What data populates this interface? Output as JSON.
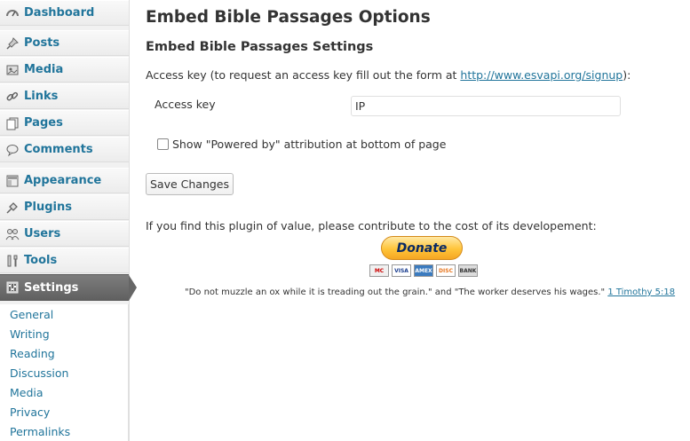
{
  "sidebar": {
    "items": [
      {
        "label": "Dashboard",
        "icon": "dashboard-icon"
      },
      {
        "label": "Posts",
        "icon": "pin-icon"
      },
      {
        "label": "Media",
        "icon": "media-icon"
      },
      {
        "label": "Links",
        "icon": "link-icon"
      },
      {
        "label": "Pages",
        "icon": "pages-icon"
      },
      {
        "label": "Comments",
        "icon": "comment-icon"
      },
      {
        "label": "Appearance",
        "icon": "appearance-icon"
      },
      {
        "label": "Plugins",
        "icon": "plugin-icon"
      },
      {
        "label": "Users",
        "icon": "users-icon"
      },
      {
        "label": "Tools",
        "icon": "tools-icon"
      },
      {
        "label": "Settings",
        "icon": "settings-icon"
      }
    ],
    "submenu": [
      "General",
      "Writing",
      "Reading",
      "Discussion",
      "Media",
      "Privacy",
      "Permalinks"
    ]
  },
  "main": {
    "title": "Embed Bible Passages Options",
    "section_title": "Embed Bible Passages Settings",
    "access_intro": "Access key (to request an access key fill out the form at ",
    "access_link": "http://www.esvapi.org/signup",
    "access_outro": "):",
    "access_label": "Access key",
    "access_value": "IP",
    "checkbox_label": "Show \"Powered by\" attribution at bottom of page",
    "checkbox_checked": false,
    "save_label": "Save Changes",
    "contribute_text": "If you find this plugin of value, please contribute to the cost of its developement:",
    "donate_label": "Donate",
    "cards": [
      "MC",
      "VISA",
      "AMEX",
      "DISC",
      "BANK"
    ],
    "quote_text": "\"Do not muzzle an ox while it is treading out the grain.\" and \"The worker deserves his wages.\"",
    "quote_ref": "1 Timothy 5:18"
  },
  "colors": {
    "link": "#21759b",
    "current_menu": "#6d6d6d",
    "donate": "#ffc439"
  }
}
